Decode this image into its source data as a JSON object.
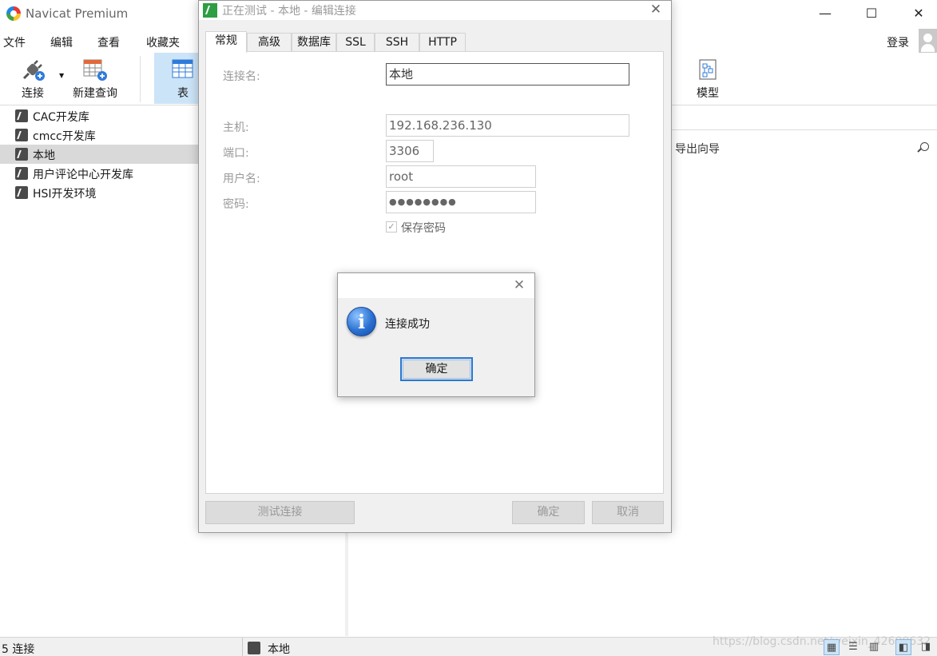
{
  "app": {
    "title": "Navicat Premium",
    "login_label": "登录"
  },
  "menu": [
    "文件",
    "编辑",
    "查看",
    "收藏夹"
  ],
  "toolbar": {
    "connect_label": "连接",
    "new_query_label": "新建查询",
    "table_label": "表",
    "model_label": "模型"
  },
  "connections": [
    {
      "label": "CAC开发库",
      "selected": false
    },
    {
      "label": "cmcc开发库",
      "selected": false
    },
    {
      "label": "本地",
      "selected": true
    },
    {
      "label": "用户评论中心开发库",
      "selected": false
    },
    {
      "label": "HSI开发环境",
      "selected": false
    }
  ],
  "main": {
    "export_wizard_label": "导出向导"
  },
  "status": {
    "count": "5 连接",
    "current_connection": "本地",
    "watermark": "https://blog.csdn.net/weixin_42600632"
  },
  "dialog": {
    "title": "正在测试 - 本地 - 编辑连接",
    "tabs": [
      "常规",
      "高级",
      "数据库",
      "SSL",
      "SSH",
      "HTTP"
    ],
    "fields": {
      "conn_name_label": "连接名:",
      "conn_name_value": "本地",
      "host_label": "主机:",
      "host_value": "192.168.236.130",
      "port_label": "端口:",
      "port_value": "3306",
      "user_label": "用户名:",
      "user_value": "root",
      "password_label": "密码:",
      "password_value": "●●●●●●●●"
    },
    "save_password_label": "保存密码",
    "save_password_checked": true,
    "test_button": "测试连接",
    "ok_button": "确定",
    "cancel_button": "取消"
  },
  "message_box": {
    "text": "连接成功",
    "ok_button": "确定",
    "icon": "info-icon"
  },
  "colors": {
    "selection": "#cce4f7",
    "dialog_bg": "#f0f0f0",
    "focus_border": "#2a78d2",
    "title_icon": "#2e9e44"
  }
}
